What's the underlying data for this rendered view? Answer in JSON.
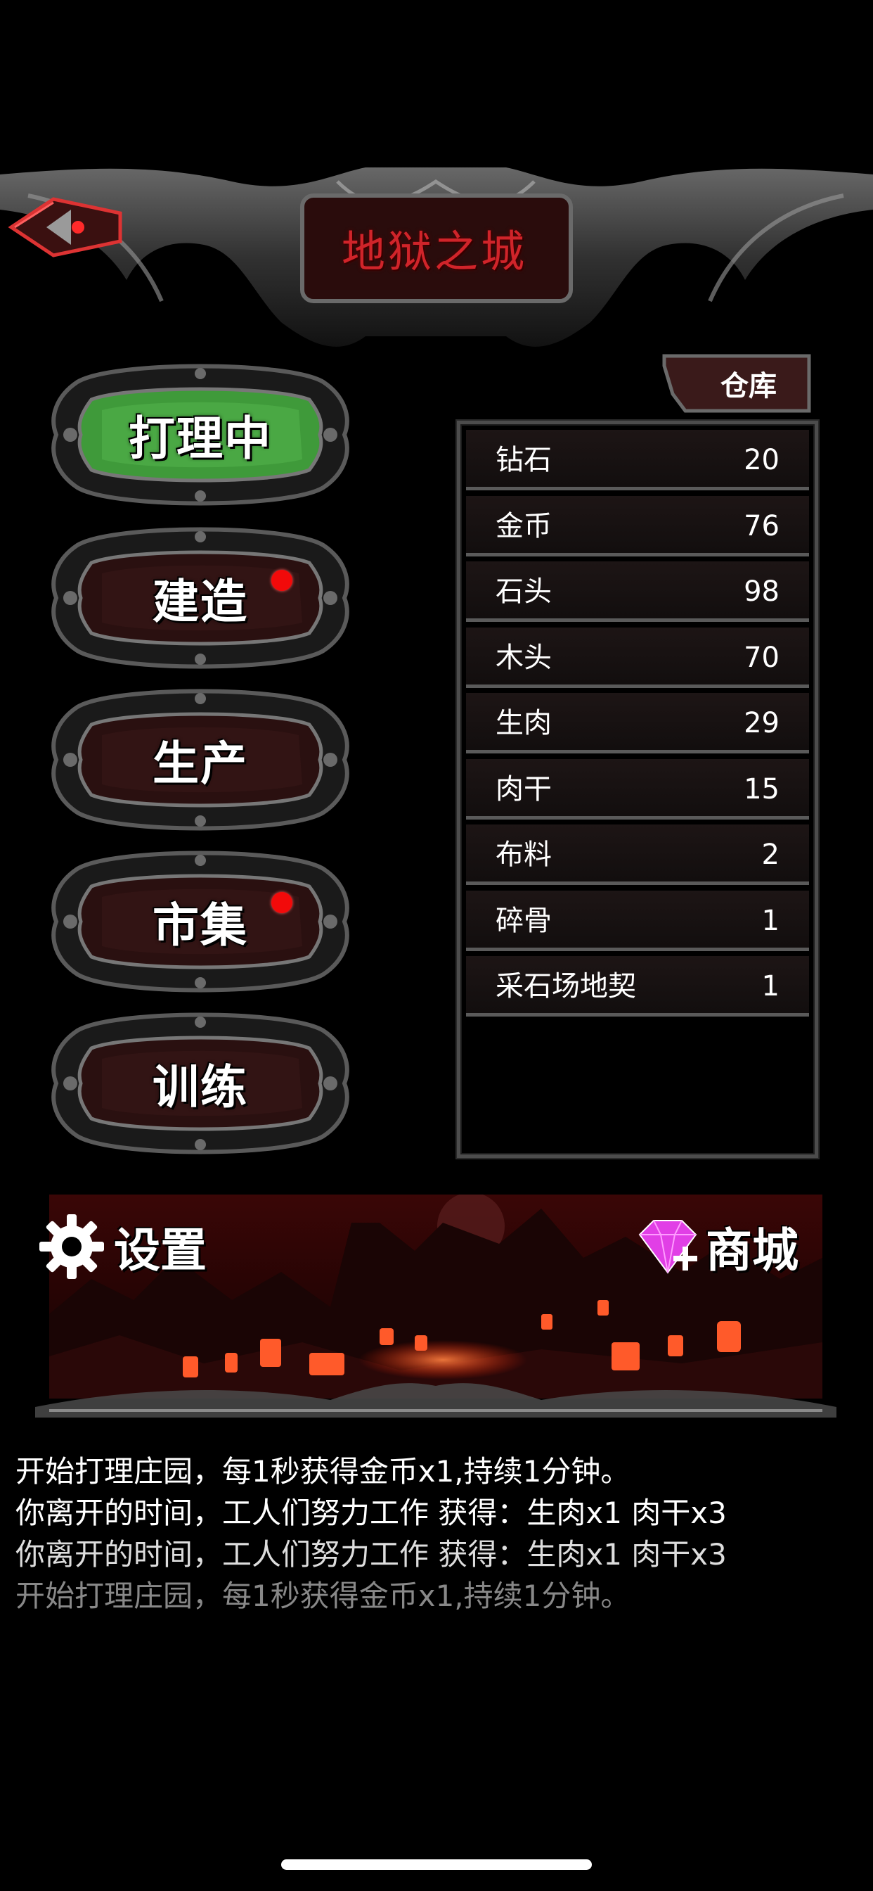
{
  "header": {
    "title": "地狱之城"
  },
  "menu": [
    {
      "label": "打理中",
      "active": true,
      "badge": false
    },
    {
      "label": "建造",
      "active": false,
      "badge": true
    },
    {
      "label": "生产",
      "active": false,
      "badge": false
    },
    {
      "label": "市集",
      "active": false,
      "badge": true
    },
    {
      "label": "训练",
      "active": false,
      "badge": false
    }
  ],
  "warehouse": {
    "tab_label": "仓库",
    "items": [
      {
        "name": "钻石",
        "qty": "20"
      },
      {
        "name": "金币",
        "qty": "76"
      },
      {
        "name": "石头",
        "qty": "98"
      },
      {
        "name": "木头",
        "qty": "70"
      },
      {
        "name": "生肉",
        "qty": "29"
      },
      {
        "name": "肉干",
        "qty": "15"
      },
      {
        "name": "布料",
        "qty": "2"
      },
      {
        "name": "碎骨",
        "qty": "1"
      },
      {
        "name": "采石场地契",
        "qty": "1"
      }
    ]
  },
  "bottom": {
    "settings_label": "设置",
    "shop_label": "商城"
  },
  "log": [
    "开始打理庄园，每1秒获得金币x1,持续1分钟。",
    "你离开的时间，工人们努力工作 获得：生肉x1 肉干x3",
    "你离开的时间，工人们努力工作 获得：生肉x1 肉干x3",
    "开始打理庄园，每1秒获得金币x1,持续1分钟。"
  ],
  "colors": {
    "title_red": "#d0242a",
    "active_green": "#3f9a3a",
    "badge_red": "#f20a0a"
  }
}
